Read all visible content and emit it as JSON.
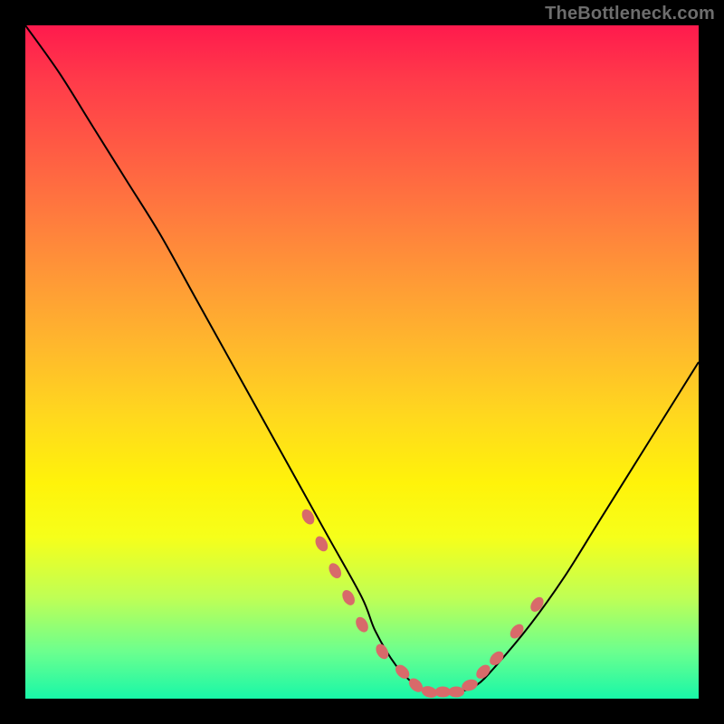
{
  "watermark": "TheBottleneck.com",
  "chart_data": {
    "type": "line",
    "title": "",
    "xlabel": "",
    "ylabel": "",
    "xlim": [
      0,
      100
    ],
    "ylim": [
      0,
      100
    ],
    "grid": false,
    "legend": false,
    "annotations": [],
    "series": [
      {
        "name": "curve",
        "color": "#000000",
        "x": [
          0,
          5,
          10,
          15,
          20,
          25,
          30,
          35,
          40,
          45,
          50,
          52,
          55,
          58,
          61,
          64,
          67,
          70,
          75,
          80,
          85,
          90,
          95,
          100
        ],
        "y": [
          100,
          93,
          85,
          77,
          69,
          60,
          51,
          42,
          33,
          24,
          15,
          10,
          5,
          2,
          1,
          1,
          2,
          5,
          11,
          18,
          26,
          34,
          42,
          50
        ]
      },
      {
        "name": "markers",
        "color": "#d86a6a",
        "marker": "pill",
        "x": [
          42,
          44,
          46,
          48,
          50,
          53,
          56,
          58,
          60,
          62,
          64,
          66,
          68,
          70,
          73,
          76
        ],
        "y": [
          27,
          23,
          19,
          15,
          11,
          7,
          4,
          2,
          1,
          1,
          1,
          2,
          4,
          6,
          10,
          14
        ]
      }
    ]
  },
  "plot_style": {
    "curve_stroke": "#000000",
    "curve_width": 2,
    "marker_fill": "#d86a6a",
    "marker_rx": 9,
    "marker_ry": 6
  }
}
